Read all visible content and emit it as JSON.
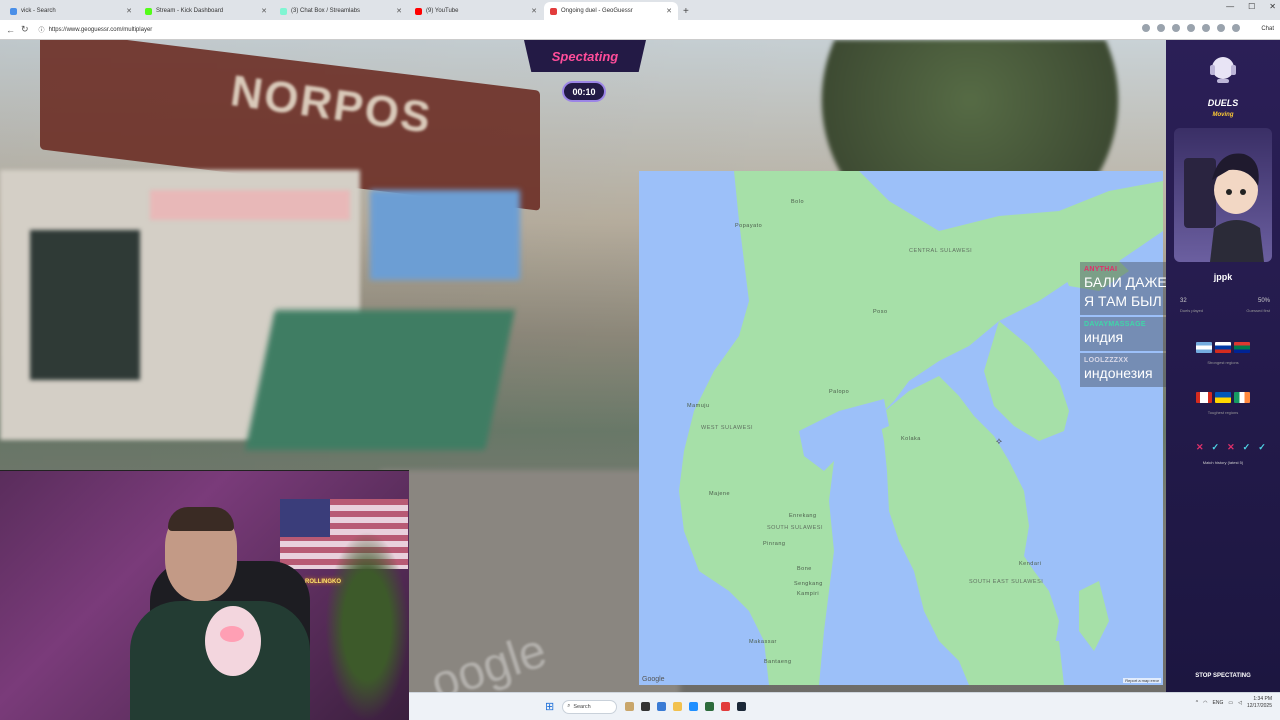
{
  "browser": {
    "tabs": [
      {
        "label": "vick - Search",
        "color": "#4a8fe8",
        "active": false
      },
      {
        "label": "Stream - Kick Dashboard",
        "color": "#53fc18",
        "active": false
      },
      {
        "label": "(3) Chat Box / Streamlabs",
        "color": "#80f5d2",
        "active": false
      },
      {
        "label": "(9) YouTube",
        "color": "#ff0000",
        "active": false
      },
      {
        "label": "Ongoing duel - GeoGuessr",
        "color": "#e23c3c",
        "active": true
      }
    ],
    "url": "https://www.geoguessr.com/multiplayer",
    "chat_button": "Chat"
  },
  "game": {
    "header": "Spectating",
    "timer": "00:10",
    "watermark": "oogle"
  },
  "map": {
    "regions": [
      "CENTRAL SULAWESI",
      "WEST SULAWESI",
      "SOUTH SULAWESI",
      "SOUTH EAST SULAWESI"
    ],
    "cities": [
      "Bolo",
      "Popayato",
      "Poso",
      "Mamuju",
      "Majene",
      "Palopo",
      "Kolaka",
      "Kendari",
      "Makassar",
      "Enrekang",
      "Pinrang",
      "Sengkang",
      "Bone",
      "Kampiri",
      "Bantaeng"
    ],
    "google": "Google",
    "report": "Report a map error"
  },
  "chat": {
    "messages": [
      {
        "user": "ANYTHAI",
        "user_color": "#e0306a",
        "text": "БАЛИ ДАЖЕ НАВЕРНОЕ Я ТАМ БЫЛ"
      },
      {
        "user": "DAVAYMASSAGE",
        "user_color": "#3fd6a8",
        "text": "индия"
      },
      {
        "user": "LOOLZZZXX",
        "user_color": "#d8d8e8",
        "text": "индонезия"
      }
    ]
  },
  "sidebar": {
    "mode": "DUELS",
    "status": "Moving",
    "player": "jppk",
    "stats": {
      "duels_played": "32",
      "duels_label": "Duels played",
      "guessed_first": "50%",
      "guessed_label": "Guessed first"
    },
    "strongest_label": "Strongest regions",
    "toughest_label": "Toughest regions",
    "history_label": "Match history (latest 5)",
    "history": [
      "✕",
      "✓",
      "✕",
      "✓",
      "✓"
    ],
    "stop_button": "STOP SPECTATING",
    "colors": {
      "accent": "#ffcc33",
      "win": "#4fd6e8",
      "loss": "#e0306a"
    }
  },
  "webcam": {
    "neon_sign": "ROLLINGKO"
  },
  "taskbar": {
    "search": "Search",
    "lang": "ENG",
    "time": "1:34 PM",
    "date": "12/17/2025"
  }
}
